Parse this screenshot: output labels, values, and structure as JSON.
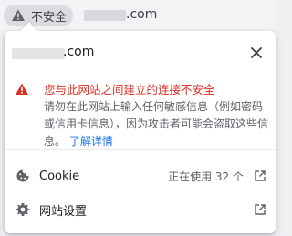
{
  "omnibox": {
    "security_label": "不安全",
    "url_suffix": ".com"
  },
  "bubble": {
    "host_suffix": ".com",
    "warning": {
      "title": "您与此网站之间建立的连接不安全",
      "body": "请勿在此网站上输入任何敏感信息（例如密码或信用卡信息），因为攻击者可能会盗取这些信息。",
      "link": "了解详情"
    },
    "cookie": {
      "label": "Cookie",
      "count_text": "正在使用 32 个"
    },
    "site_settings": {
      "label": "网站设置"
    }
  },
  "colors": {
    "warning_red": "#d93025",
    "link_blue": "#1a73e8",
    "chip_bg": "#dadce0"
  },
  "icons": [
    "warning-triangle-icon",
    "close-icon",
    "cookie-icon",
    "gear-icon",
    "external-link-icon"
  ]
}
